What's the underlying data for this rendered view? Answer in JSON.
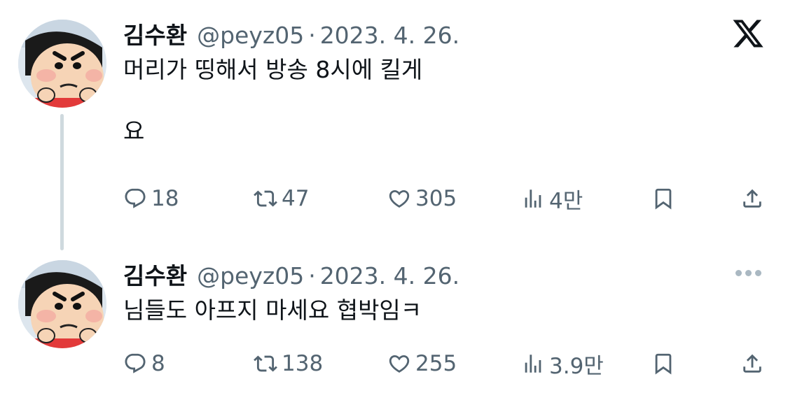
{
  "tweets": [
    {
      "name": "김수환",
      "handle": "@peyz05",
      "separator": "·",
      "date": "2023. 4. 26.",
      "text": "머리가 띵해서 방송 8시에 킬게\n\n요",
      "replies": "18",
      "retweets": "47",
      "likes": "305",
      "views": "4만"
    },
    {
      "name": "김수환",
      "handle": "@peyz05",
      "separator": "·",
      "date": "2023. 4. 26.",
      "text": "님들도 아프지 마세요 협박임ㅋ",
      "replies": "8",
      "retweets": "138",
      "likes": "255",
      "views": "3.9만"
    }
  ],
  "icons": {
    "logo": "x-logo-icon",
    "reply": "reply-icon",
    "retweet": "retweet-icon",
    "like": "heart-icon",
    "views": "views-icon",
    "bookmark": "bookmark-icon",
    "share": "share-icon",
    "more": "more-icon"
  },
  "colors": {
    "text": "#0f1419",
    "secondary": "#536471",
    "thread_line": "#cfd9de"
  }
}
